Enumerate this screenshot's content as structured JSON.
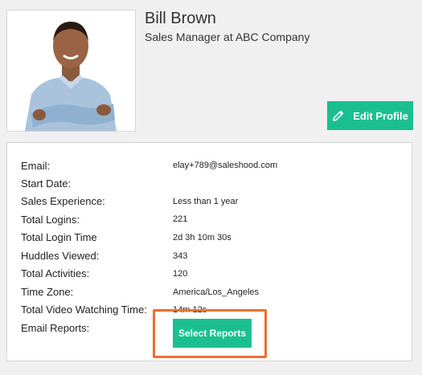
{
  "profile": {
    "name": "Bill Brown",
    "title": "Sales Manager at ABC Company",
    "edit_label": "Edit Profile"
  },
  "details": {
    "email_label": "Email:",
    "email_value": "elay+789@saleshood.com",
    "start_date_label": "Start Date:",
    "start_date_value": "",
    "sales_experience_label": "Sales Experience:",
    "sales_experience_value": "Less than 1 year",
    "total_logins_label": "Total Logins:",
    "total_logins_value": "221",
    "total_login_time_label": "Total Login Time",
    "total_login_time_value": "2d 3h 10m 30s",
    "huddles_viewed_label": "Huddles Viewed:",
    "huddles_viewed_value": "343",
    "total_activities_label": "Total Activities:",
    "total_activities_value": "120",
    "time_zone_label": "Time Zone:",
    "time_zone_value": "America/Los_Angeles",
    "video_watching_label": "Total Video Watching Time:",
    "video_watching_value": "14m 12s",
    "email_reports_label": "Email Reports:",
    "select_reports_label": "Select Reports"
  },
  "colors": {
    "accent": "#1bbf8f",
    "highlight": "#ee6f30"
  },
  "icons": {
    "edit": "pencil-icon",
    "photo": "avatar"
  }
}
